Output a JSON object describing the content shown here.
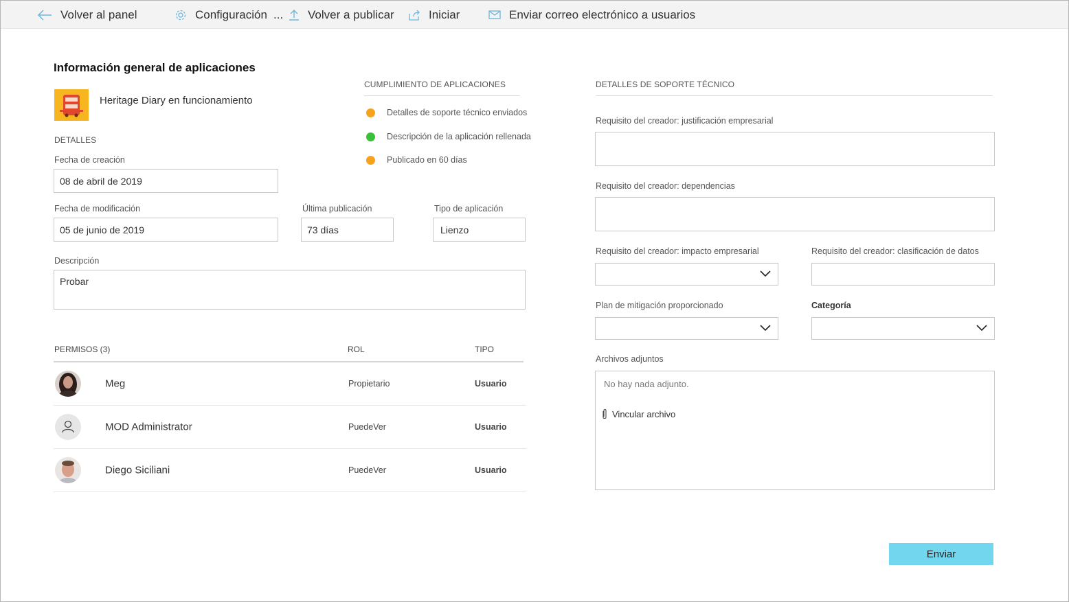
{
  "toolbar": {
    "back_label": "Volver al panel",
    "settings_label": "Configuración",
    "more_label": "...",
    "republish_label": "Volver a publicar",
    "launch_label": "Iniciar",
    "email_label": "Enviar correo electrónico a usuarios"
  },
  "overview": {
    "title": "Información general de aplicaciones",
    "app_name": "Heritage Diary en funcionamiento",
    "details_label": "DETALLES",
    "created_label": "Fecha de creación",
    "created_value": "08 de abril de 2019",
    "modified_label": "Fecha de modificación",
    "modified_value": "05 de junio de 2019",
    "last_published_label": "Última publicación",
    "last_published_value": "73 días",
    "app_type_label": "Tipo de aplicación",
    "app_type_value": "Lienzo",
    "description_label": "Descripción",
    "description_value": "Probar"
  },
  "compliance": {
    "title": "CUMPLIMIENTO DE APLICACIONES",
    "items": [
      {
        "label": "Detalles de soporte técnico enviados",
        "color": "#f7a21b"
      },
      {
        "label": "Descripción de la aplicación rellenada",
        "color": "#3ac13a"
      },
      {
        "label": "Publicado en 60 días",
        "color": "#f7a21b"
      }
    ]
  },
  "permissions": {
    "header": "PERMISOS (3)",
    "role_header": "ROL",
    "type_header": "TIPO",
    "rows": [
      {
        "name": "Meg",
        "role": "Propietario",
        "type": "Usuario"
      },
      {
        "name": "MOD Administrator",
        "role": "PuedeVer",
        "type": "Usuario"
      },
      {
        "name": "Diego Siciliani",
        "role": "PuedeVer",
        "type": "Usuario"
      }
    ]
  },
  "support": {
    "title": "DETALLES DE SOPORTE TÉCNICO",
    "justification_label": "Requisito del creador: justificación empresarial",
    "dependencies_label": "Requisito del creador: dependencias",
    "impact_label": "Requisito del creador: impacto empresarial",
    "data_class_label": "Requisito del creador: clasificación de datos",
    "mitigation_label": "Plan de mitigación proporcionado",
    "category_label": "Categoría",
    "attachments_label": "Archivos adjuntos",
    "no_attachments": "No hay nada adjunto.",
    "attach_file": "Vincular archivo",
    "submit_label": "Enviar"
  }
}
